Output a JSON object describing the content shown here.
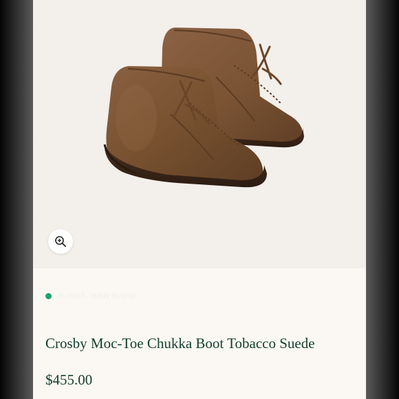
{
  "product": {
    "title": "Crosby Moc-Toe Chukka Boot Tobacco Suede",
    "price": "$455.00",
    "image_alt": "Crosby Moc-Toe Chukka Boot Tobacco Suede"
  },
  "stock": {
    "label": "In stock, ready to ship",
    "indicator_color": "#1fa36a"
  },
  "icons": {
    "zoom": "zoom-in-icon"
  },
  "colors": {
    "title_text": "#16402f",
    "image_background": "#f3efeb",
    "page_background": "#fbf8f3",
    "suede": "#7a5436"
  }
}
